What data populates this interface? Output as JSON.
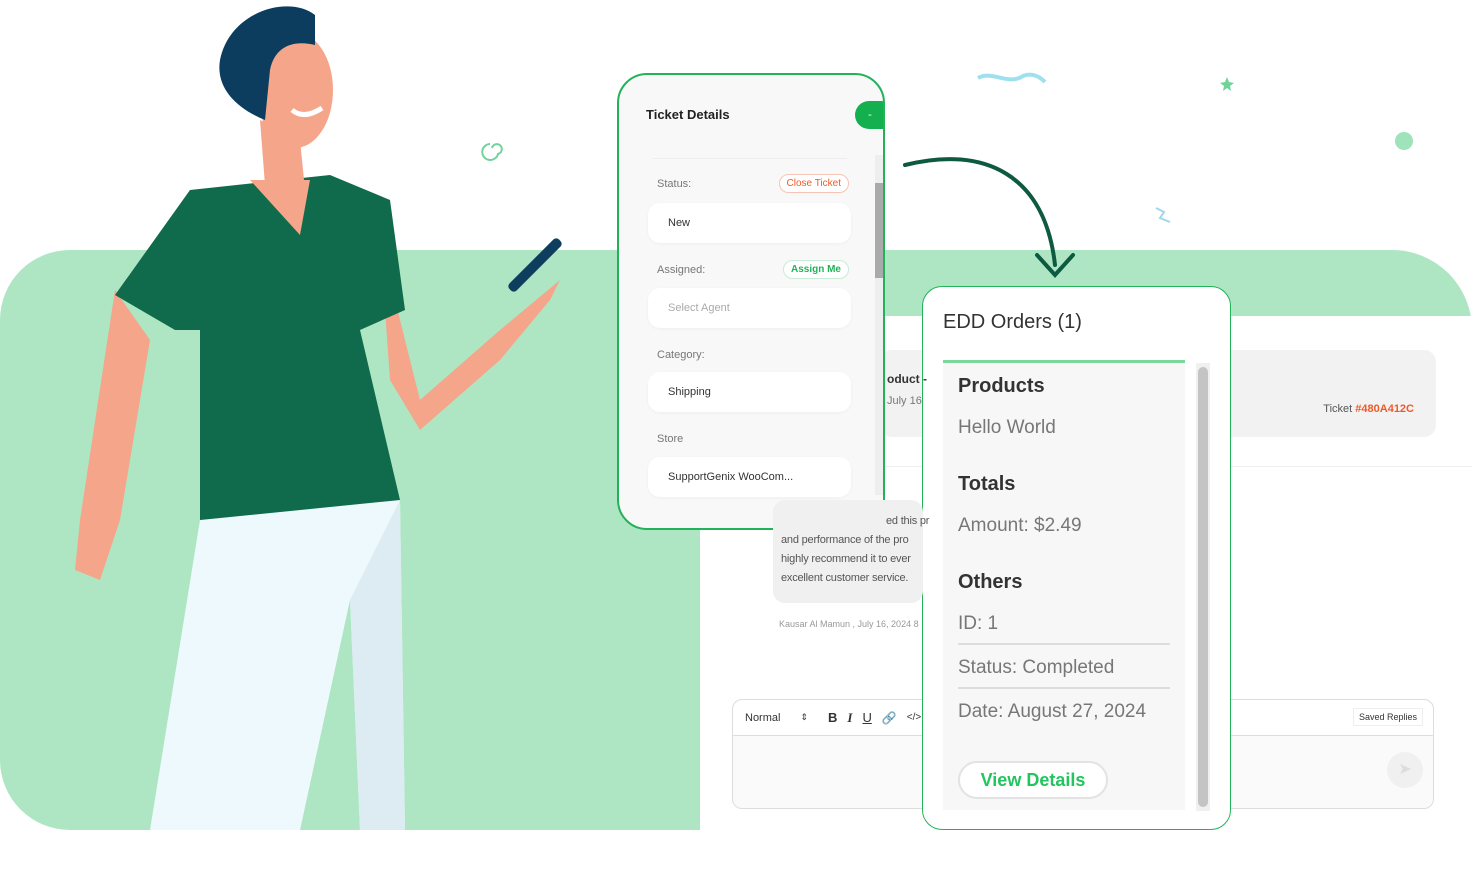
{
  "ticket_details": {
    "title": "Ticket Details",
    "toggle_label": "-",
    "status_label": "Status:",
    "close_ticket": "Close Ticket",
    "status_value": "New",
    "assigned_label": "Assigned:",
    "assign_me": "Assign Me",
    "agent_placeholder": "Select Agent",
    "category_label": "Category:",
    "category_value": "Shipping",
    "store_label": "Store",
    "store_value": "SupportGenix WooCom..."
  },
  "edd_orders": {
    "title": "EDD Orders (1)",
    "products_heading": "Products",
    "product": "Hello World",
    "totals_heading": "Totals",
    "amount": "Amount: $2.49",
    "others_heading": "Others",
    "id": "ID: 1",
    "status": "Status: Completed",
    "date": "Date: August 27, 2024",
    "view_details": "View Details"
  },
  "background_ticket": {
    "product_fragment": "oduct -",
    "date_fragment": "July 16",
    "ticket_label": "Ticket",
    "ticket_id": "#480A412C",
    "review_lines": [
      "ed this pr",
      "and performance of the pro",
      "highly recommend it to ever",
      "excellent customer service."
    ],
    "author_line": "Kausar Al Mamun , July 16, 2024 8"
  },
  "editor": {
    "format": "Normal",
    "bold": "B",
    "italic": "I",
    "underline": "U",
    "link_icon": "link-icon",
    "code": "</>",
    "saved_replies": "Saved Replies",
    "send_icon": "send-icon"
  },
  "colors": {
    "brand_green": "#22b25a",
    "bg_green": "#aee6c4",
    "ticket_id": "#f05a28",
    "close_ticket": "#f05a28"
  }
}
